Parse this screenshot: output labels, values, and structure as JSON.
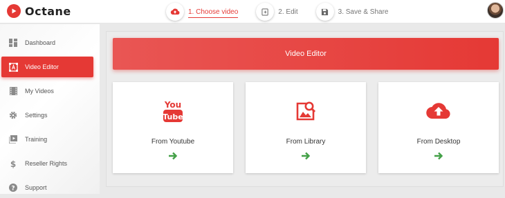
{
  "app": {
    "logo_text": "Octane"
  },
  "steps": [
    {
      "label": "1. Choose video",
      "icon": "cloud-upload-icon",
      "active": true
    },
    {
      "label": "2. Edit",
      "icon": "edit-icon",
      "active": false
    },
    {
      "label": "3. Save & Share",
      "icon": "save-icon",
      "active": false
    }
  ],
  "sidebar": {
    "items": [
      {
        "label": "Dashboard",
        "icon": "dashboard-icon"
      },
      {
        "label": "Video Editor",
        "icon": "video-editor-icon",
        "active": true
      },
      {
        "label": "My Videos",
        "icon": "film-icon"
      },
      {
        "label": "Settings",
        "icon": "gear-icon"
      },
      {
        "label": "Training",
        "icon": "play-box-icon"
      },
      {
        "label": "Reseller Rights",
        "icon": "dollar-icon"
      },
      {
        "label": "Support",
        "icon": "help-icon"
      }
    ]
  },
  "main": {
    "header_title": "Video Editor",
    "cards": [
      {
        "label": "From Youtube",
        "icon": "youtube-icon"
      },
      {
        "label": "From Library",
        "icon": "image-search-icon"
      },
      {
        "label": "From Desktop",
        "icon": "cloud-upload-icon"
      }
    ]
  },
  "colors": {
    "accent": "#e53935",
    "arrow": "#43a047"
  }
}
